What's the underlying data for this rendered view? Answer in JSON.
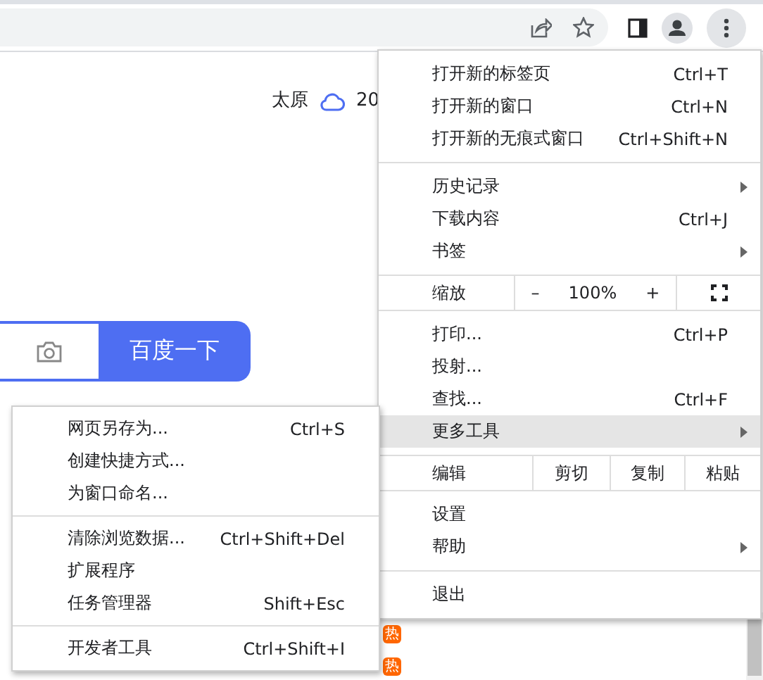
{
  "toolbar": {
    "menu_button": {
      "pressed": true
    }
  },
  "page": {
    "weather": {
      "city": "太原",
      "temperature": "20"
    },
    "search": {
      "button": "百度一下"
    },
    "badges": [
      {
        "text": "热"
      },
      {
        "text": "热"
      }
    ]
  },
  "menu": {
    "groups": [
      {
        "kind": "list",
        "items": [
          {
            "label": "打开新的标签页",
            "shortcut": "Ctrl+T",
            "submenu": false,
            "selected": false
          },
          {
            "label": "打开新的窗口",
            "shortcut": "Ctrl+N",
            "submenu": false,
            "selected": false
          },
          {
            "label": "打开新的无痕式窗口",
            "shortcut": "Ctrl+Shift+N",
            "submenu": false,
            "selected": false
          }
        ]
      },
      {
        "kind": "list",
        "items": [
          {
            "label": "历史记录",
            "submenu": true,
            "selected": false
          },
          {
            "label": "下载内容",
            "shortcut": "Ctrl+J",
            "submenu": false,
            "selected": false
          },
          {
            "label": "书签",
            "submenu": true,
            "selected": false
          }
        ]
      },
      {
        "kind": "zoom",
        "label": "缩放",
        "minus": "–",
        "value": "100%",
        "plus": "+"
      },
      {
        "kind": "list",
        "items": [
          {
            "label": "打印...",
            "shortcut": "Ctrl+P",
            "submenu": false,
            "selected": false
          },
          {
            "label": "投射...",
            "submenu": false,
            "selected": false
          },
          {
            "label": "查找...",
            "shortcut": "Ctrl+F",
            "submenu": false,
            "selected": false
          },
          {
            "label": "更多工具",
            "submenu": true,
            "selected": true
          }
        ]
      },
      {
        "kind": "edit",
        "label": "编辑",
        "actions": [
          "剪切",
          "复制",
          "粘贴"
        ]
      },
      {
        "kind": "list",
        "items": [
          {
            "label": "设置",
            "submenu": false,
            "selected": false
          },
          {
            "label": "帮助",
            "submenu": true,
            "selected": false
          }
        ]
      },
      {
        "kind": "list",
        "items": [
          {
            "label": "退出",
            "submenu": false,
            "selected": false
          }
        ]
      }
    ]
  },
  "submenu": {
    "groups": [
      {
        "kind": "list",
        "items": [
          {
            "label": "网页另存为...",
            "shortcut": "Ctrl+S",
            "submenu": false,
            "selected": false
          },
          {
            "label": "创建快捷方式...",
            "submenu": false,
            "selected": false
          },
          {
            "label": "为窗口命名...",
            "submenu": false,
            "selected": false
          }
        ]
      },
      {
        "kind": "list",
        "items": [
          {
            "label": "清除浏览数据...",
            "shortcut": "Ctrl+Shift+Del",
            "submenu": false,
            "selected": false
          },
          {
            "label": "扩展程序",
            "submenu": false,
            "selected": false
          },
          {
            "label": "任务管理器",
            "shortcut": "Shift+Esc",
            "submenu": false,
            "selected": false
          }
        ]
      },
      {
        "kind": "list",
        "items": [
          {
            "label": "开发者工具",
            "shortcut": "Ctrl+Shift+I",
            "submenu": false,
            "selected": false
          }
        ]
      }
    ]
  }
}
